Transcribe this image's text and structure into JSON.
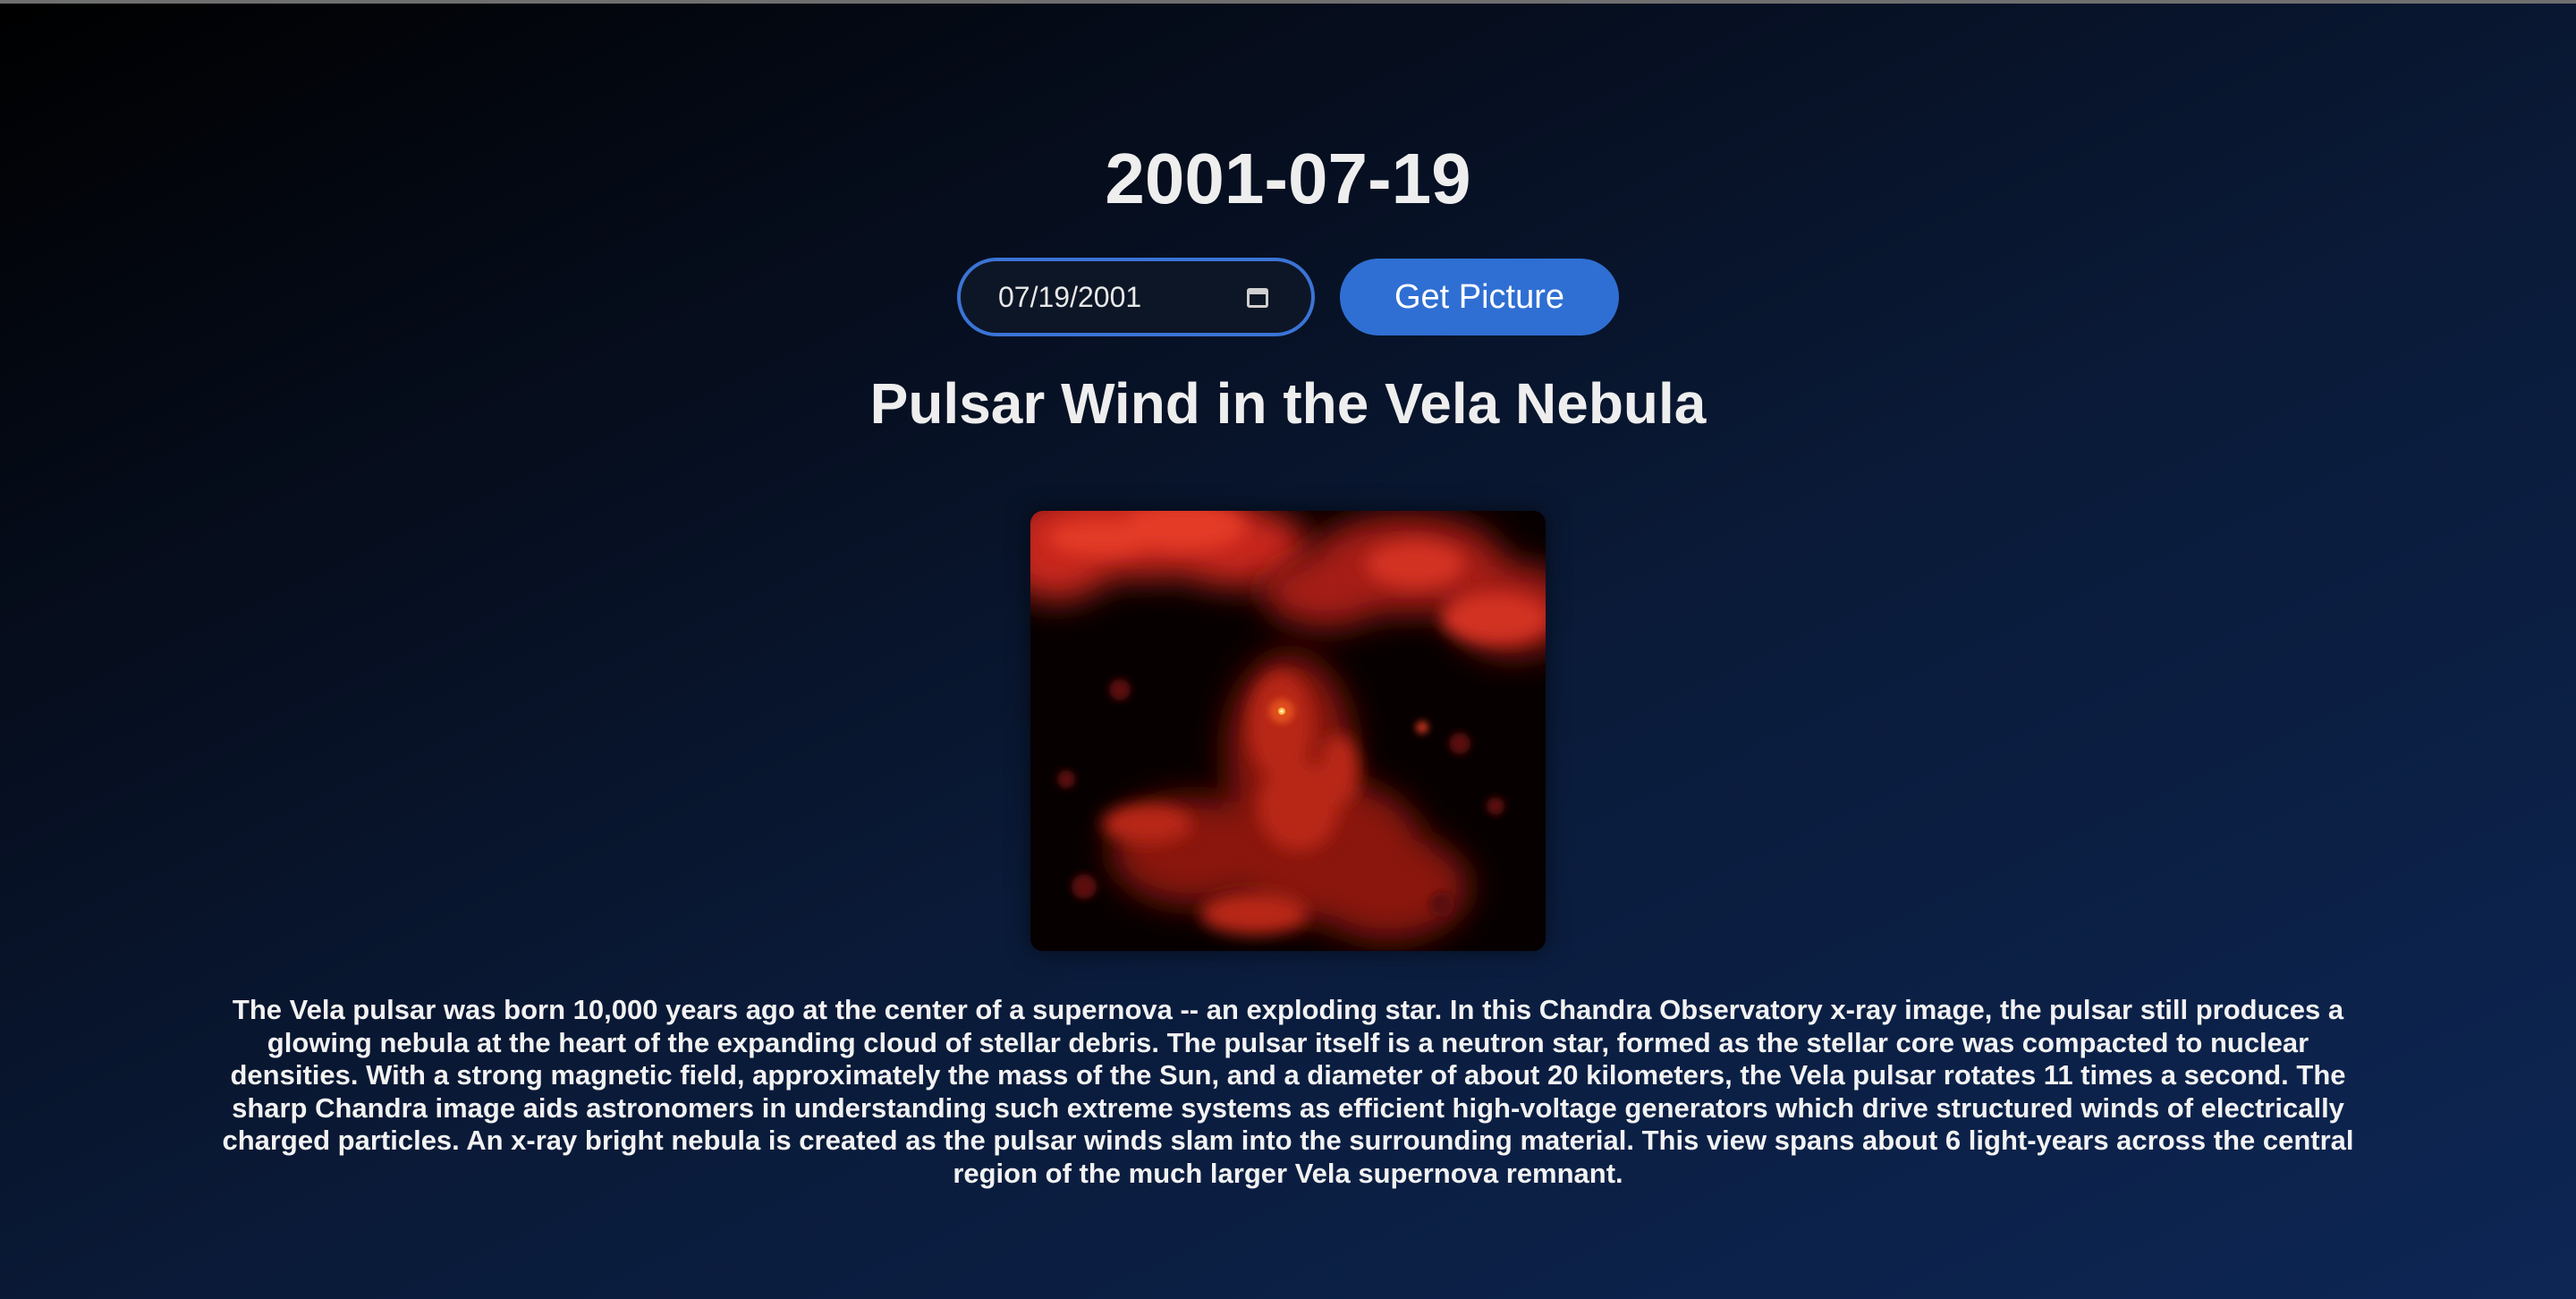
{
  "date_heading": "2001-07-19",
  "date_input": {
    "value": "07/19/2001"
  },
  "get_button_label": "Get Picture",
  "picture": {
    "title": "Pulsar Wind in the Vela Nebula",
    "explanation": "The Vela pulsar was born 10,000 years ago at the center of a supernova -- an exploding star. In this Chandra Observatory x-ray image, the pulsar still produces a glowing nebula at the heart of the expanding cloud of stellar debris. The pulsar itself is a neutron star, formed as the stellar core was compacted to nuclear densities. With a strong magnetic field, approximately the mass of the Sun, and a diameter of about 20 kilometers, the Vela pulsar rotates 11 times a second. The sharp Chandra image aids astronomers in understanding such extreme systems as efficient high-voltage generators which drive structured winds of electrically charged particles. An x-ray bright nebula is created as the pulsar winds slam into the surrounding material. This view spans about 6 light-years across the central region of the much larger Vela supernova remnant."
  },
  "icons": {
    "date_picker": "calendar-icon"
  },
  "colors": {
    "accent": "#2f6fd3",
    "input_border": "#3b74d6",
    "nebula_red": "#d62a1c"
  }
}
